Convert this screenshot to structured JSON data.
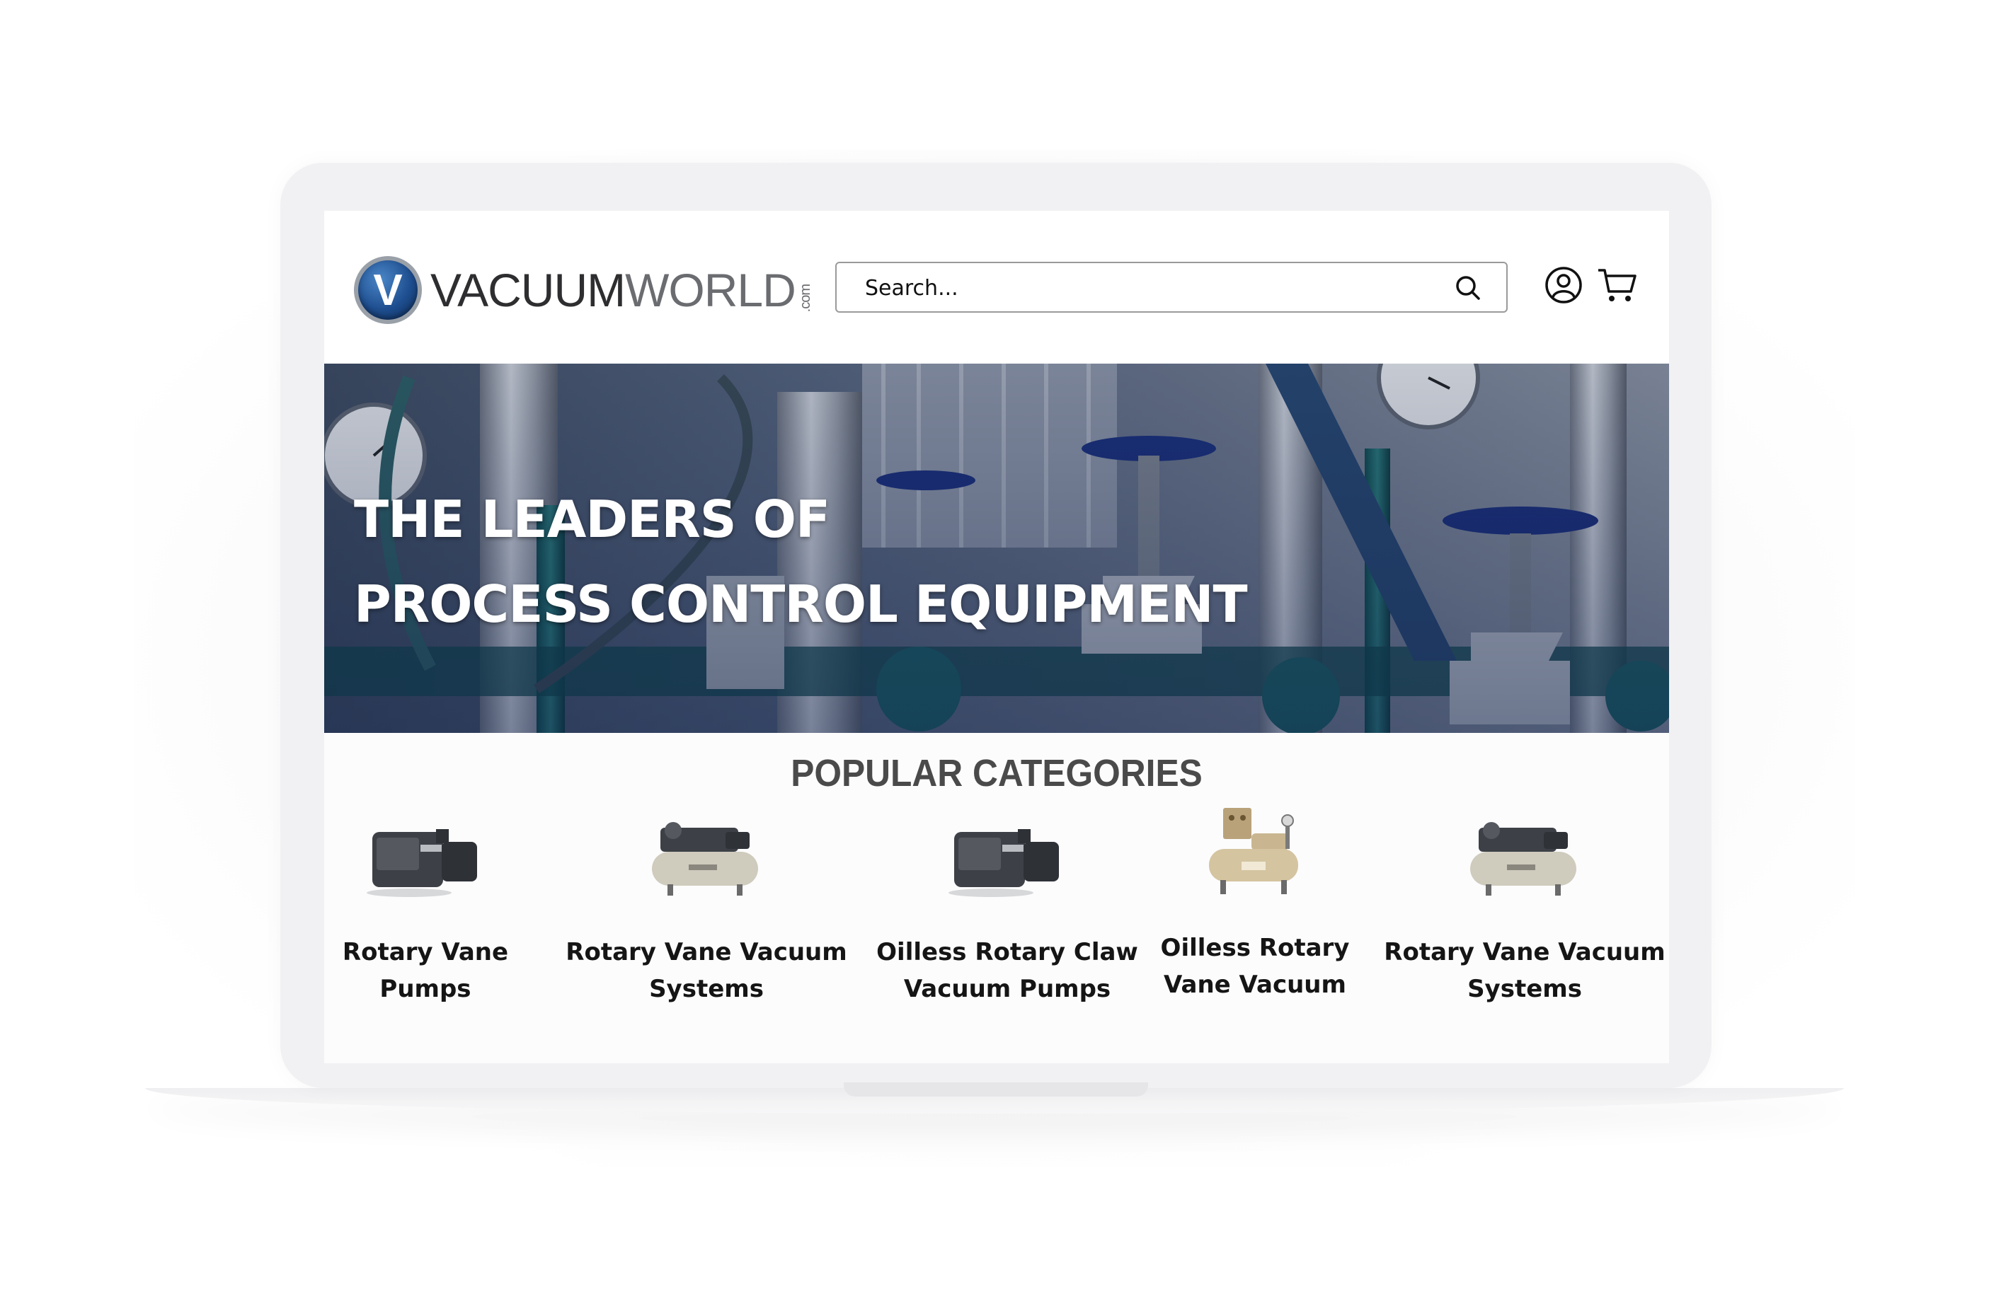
{
  "header": {
    "logo": {
      "mark_letter": "V",
      "text_primary": "VACUUM",
      "text_secondary": "WORLD",
      "text_suffix": ".com"
    },
    "search": {
      "placeholder": "Search..."
    },
    "icons": {
      "search": "search-icon",
      "account": "account-icon",
      "cart": "cart-icon"
    }
  },
  "hero": {
    "title_line1": "THE LEADERS OF",
    "title_line2": "PROCESS CONTROL EQUIPMENT"
  },
  "categories": {
    "title": "POPULAR CATEGORIES",
    "items": [
      {
        "label_line1": "Rotary Vane",
        "label_line2": "Pumps",
        "image": "rotary-vane-pump"
      },
      {
        "label_line1": "Rotary Vane Vacuum",
        "label_line2": "Systems",
        "image": "tank-vacuum-system"
      },
      {
        "label_line1": "Oilless Rotary Claw",
        "label_line2": "Vacuum Pumps",
        "image": "rotary-claw-pump"
      },
      {
        "label_line1": "Oilless Rotary",
        "label_line2": "Vane Vacuum",
        "image": "tank-vacuum-system-tan"
      },
      {
        "label_line1": "Rotary Vane Vacuum",
        "label_line2": "Systems",
        "image": "tank-vacuum-system"
      }
    ]
  },
  "colors": {
    "brand_blue": "#1e4e8f",
    "hero_overlay": "#0e1f4a",
    "heading_gray": "#4a4a4a"
  }
}
